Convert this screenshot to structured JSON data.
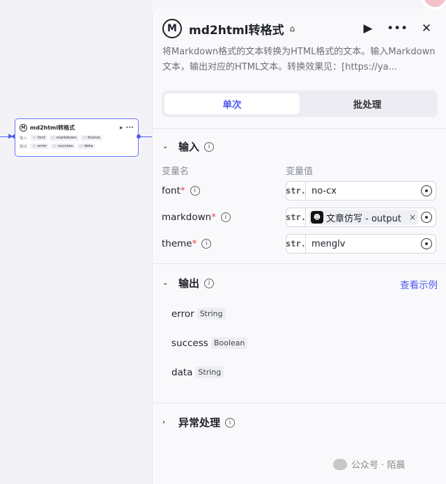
{
  "node": {
    "title": "md2html转格式",
    "logo_letter": "M",
    "description": "将Markdown格式的文本转换为HTML格式的文本。输入Markdown文本，输出对应的HTML文本。转换效果见：[https://ya...",
    "icons": {
      "store": "store-icon",
      "run": "play-icon",
      "more": "more-icon",
      "close": "close-icon"
    }
  },
  "mini_node": {
    "title": "md2html转格式",
    "input_label": "输入",
    "output_label": "输出",
    "inputs": [
      "font",
      "markdown",
      "theme"
    ],
    "outputs": [
      "error",
      "success",
      "data"
    ]
  },
  "tabs": [
    {
      "label": "单次",
      "active": true
    },
    {
      "label": "批处理",
      "active": false
    }
  ],
  "input_section": {
    "title": "输入",
    "col_name": "变量名",
    "col_value": "变量值",
    "fields": [
      {
        "name": "font",
        "required": "*",
        "type": "str.",
        "value": "no-cx"
      },
      {
        "name": "markdown",
        "required": "*",
        "type": "str.",
        "ref_label": "文章仿写 - output",
        "ref_remove": "×"
      },
      {
        "name": "theme",
        "required": "*",
        "type": "str.",
        "value": "menglv"
      }
    ]
  },
  "output_section": {
    "title": "输出",
    "link": "查看示例",
    "items": [
      {
        "name": "error",
        "type": "String"
      },
      {
        "name": "success",
        "type": "Boolean"
      },
      {
        "name": "data",
        "type": "String"
      }
    ]
  },
  "exception_section": {
    "title": "异常处理"
  },
  "watermark": "公众号 · 陌晨",
  "colors": {
    "accent": "#4e5bf0",
    "required": "#e5484d"
  }
}
